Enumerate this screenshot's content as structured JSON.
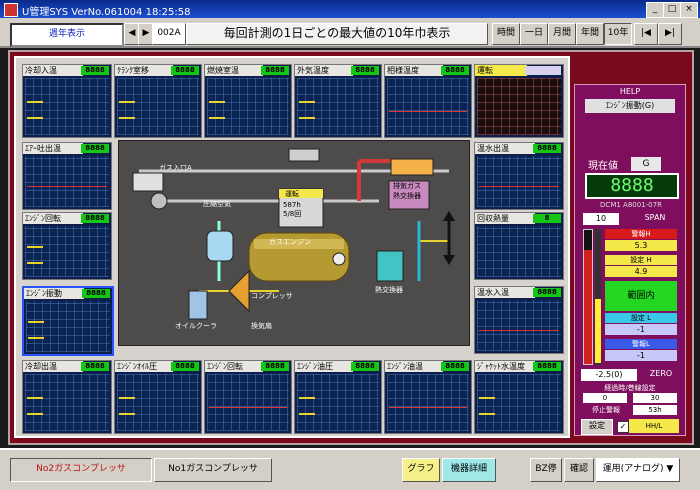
{
  "window": {
    "title": "U管理SYS  VerNo.061004        18:25:58",
    "min": "_",
    "max": "□",
    "close": "×"
  },
  "toolbar": {
    "mode_select": "週年表示",
    "prev": "◀",
    "next": "▶",
    "code": "002A",
    "main_title": "毎回計測の1日ごとの最大値の10年巾表示",
    "period_time": "時間",
    "period_day": "一日",
    "period_month": "月間",
    "period_year": "年間",
    "period_10y": "10年",
    "nav_first": "|◀",
    "nav_last": "▶|"
  },
  "gauges": [
    {
      "label": "冷却入温",
      "value": "8888"
    },
    {
      "label": "ｸﾗﾝｸ室移",
      "value": "8888"
    },
    {
      "label": "燃焼室温",
      "value": "8888"
    },
    {
      "label": "外気温度",
      "value": "8888"
    },
    {
      "label": "相様温度",
      "value": "8888"
    },
    {
      "label": "運転",
      "value": ""
    },
    {
      "label": "ｴｱｰ吐出温",
      "value": "8888"
    },
    {
      "label": "ｴﾝｼﾞﾝ回転",
      "value": "8888"
    },
    {
      "label": "ｴﾝｼﾞﾝ振動",
      "value": "8888"
    },
    {
      "label": "温水出温",
      "value": "8888"
    },
    {
      "label": "回収熱量",
      "value": "8"
    },
    {
      "label": "温水入温",
      "value": "8888"
    },
    {
      "label": "冷却出温",
      "value": "8888"
    },
    {
      "label": "ｴﾝｼﾞﾝｵｲﾙ圧",
      "value": "8888"
    },
    {
      "label": "ｴﾝｼﾞﾝ回転",
      "value": "8888"
    },
    {
      "label": "ｴﾝｼﾞﾝ油圧",
      "value": "8888"
    },
    {
      "label": "ｴﾝｼﾞﾝ油温",
      "value": "8888"
    },
    {
      "label": "ｼﾞｬｹｯﾄ水温度",
      "value": "8888"
    }
  ],
  "diagram": {
    "gas_valve": "ガス入口A",
    "compressor_inlet": "圧縮空気",
    "status_panel_title": "運転",
    "status_panel_value": "587h\n5/8回",
    "engine": "ガスエンジン",
    "exhaust_gas": "排気ガス\n熱交換器",
    "oil_cooler": "オイルクーラ",
    "compressor": "コンプレッサ",
    "ventilation": "換気扇",
    "heat_exchanger": "熱交換器"
  },
  "right_panel": {
    "header": "HELP",
    "sensor": "ｴﾝｼﾞﾝ振動(G)",
    "current_label": "現在値",
    "unit": "G",
    "current_value": "8888",
    "channel": "DCM1 A8001-07R",
    "span_value": "10",
    "span_label": "SPAN",
    "alarm_upper": "警報H",
    "alarm_upper_val": "5.3",
    "set_upper": "設定 H",
    "set_upper_val": "4.9",
    "normal": "範囲内",
    "set_lower": "設定 L",
    "set_lower_val": "-1",
    "alarm_lower": "警報L",
    "alarm_lower_val": "-1",
    "zero_val": "-2.5(0)",
    "zero_label": "ZERO",
    "elapsed_label": "経過時/巻線設定",
    "elapsed_a": "0",
    "elapsed_b": "30",
    "stop_label": "停止警報",
    "stop_val": "53h",
    "settings": "設定",
    "checkbox_label": "HH/L"
  },
  "statusbar": {
    "tab1": "No2ガスコンプレッサ",
    "tab2": "No1ガスコンプレッサ",
    "graph": "グラフ",
    "detail": "機器詳細",
    "bz": "BZ停",
    "confirm": "確認",
    "mode": "運用(アナログ)",
    "mode_arrow": "▼"
  }
}
